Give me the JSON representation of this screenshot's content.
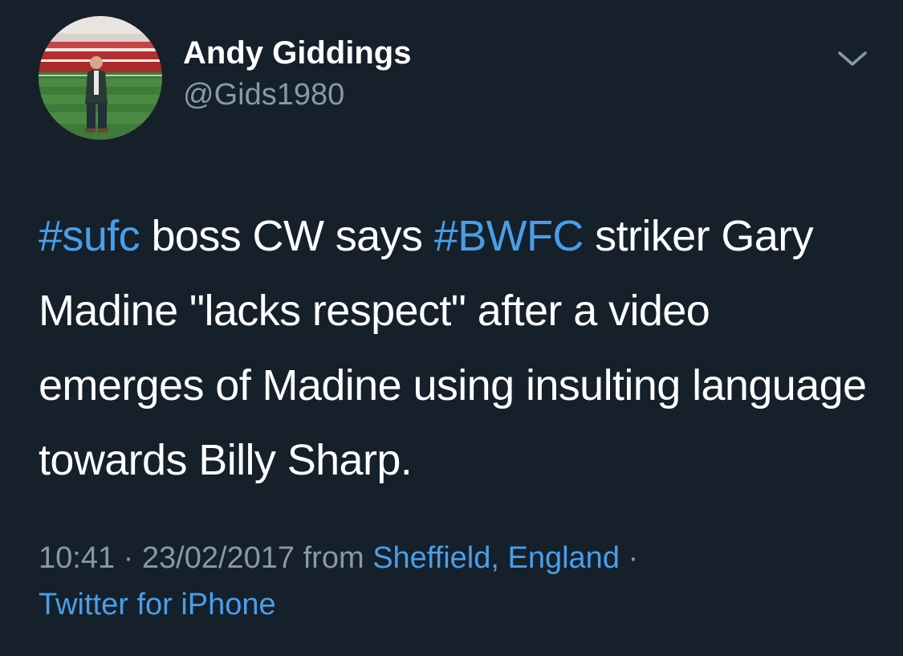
{
  "author": {
    "display_name": "Andy Giddings",
    "handle": "@Gids1980"
  },
  "icons": {
    "menu": "chevron-down-icon",
    "avatar": "profile-photo"
  },
  "colors": {
    "background": "#15202b",
    "text": "#ffffff",
    "secondary": "#8899a6",
    "link": "#4a9ee8"
  },
  "tweet": {
    "hashtag1": "#sufc",
    "text1": " boss CW says ",
    "hashtag2": "#BWFC",
    "text2": " striker Gary Madine \"lacks respect\" after a video emerges of Madine using insulting language towards Billy Sharp."
  },
  "meta": {
    "time": "10:41",
    "separator1": " · ",
    "date": "23/02/2017",
    "from": " from ",
    "location": "Sheffield, England",
    "separator2": " · ",
    "source": "Twitter for iPhone"
  }
}
